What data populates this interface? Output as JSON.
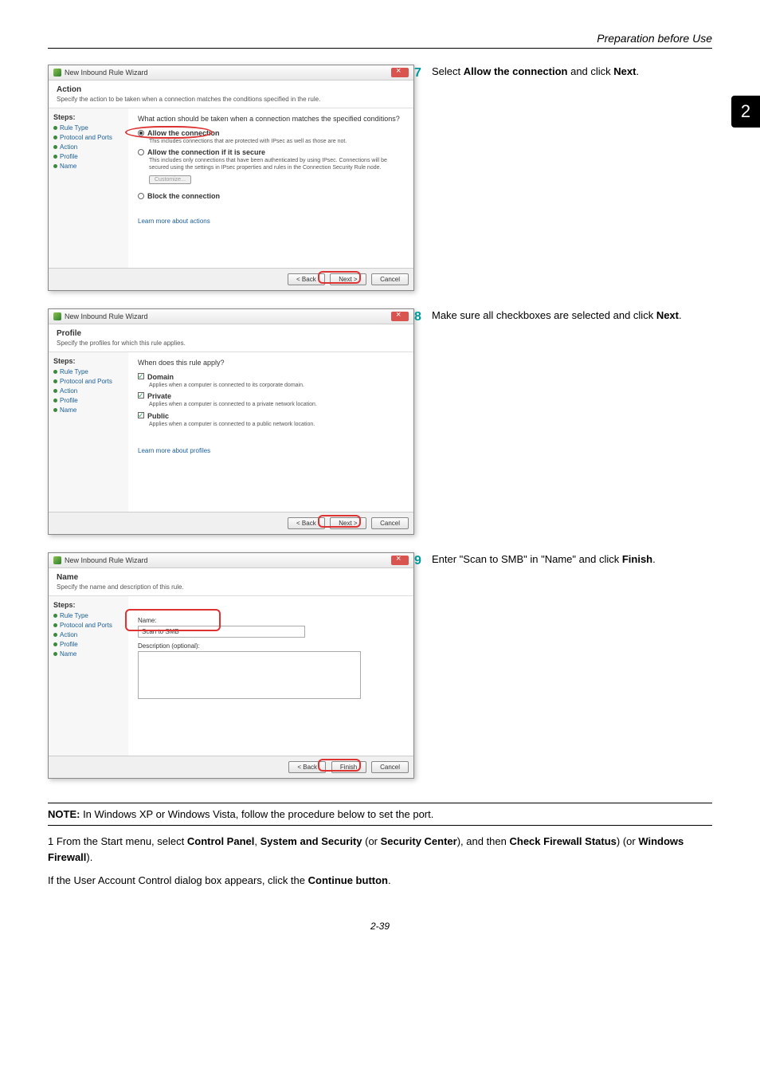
{
  "header": {
    "section_title": "Preparation before Use"
  },
  "chapter_tab": "2",
  "wizard_common": {
    "window_title": "New Inbound Rule Wizard",
    "steps_label": "Steps:",
    "steps": [
      "Rule Type",
      "Protocol and Ports",
      "Action",
      "Profile",
      "Name"
    ],
    "back": "< Back",
    "next": "Next >",
    "finish": "Finish",
    "cancel": "Cancel"
  },
  "step7": {
    "num": "7",
    "text_pre": "Select ",
    "text_bold1": "Allow the connection",
    "text_mid": " and click ",
    "text_bold2": "Next",
    "text_post": ".",
    "panel": {
      "title": "Action",
      "subtitle": "Specify the action to be taken when a connection matches the conditions specified in the rule.",
      "question": "What action should be taken when a connection matches the specified conditions?",
      "opt1_label": "Allow the connection",
      "opt1_desc": "This includes connections that are protected with IPsec as well as those are not.",
      "opt2_label": "Allow the connection if it is secure",
      "opt2_desc": "This includes only connections that have been authenticated by using IPsec. Connections will be secured using the settings in IPsec properties and rules in the Connection Security Rule node.",
      "customize": "Customize...",
      "opt3_label": "Block the connection",
      "learn": "Learn more about actions"
    }
  },
  "step8": {
    "num": "8",
    "text_pre": "Make sure all checkboxes are selected and click ",
    "text_bold": "Next",
    "text_post": ".",
    "panel": {
      "title": "Profile",
      "subtitle": "Specify the profiles for which this rule applies.",
      "question": "When does this rule apply?",
      "chk1": "Domain",
      "chk1_desc": "Applies when a computer is connected to its corporate domain.",
      "chk2": "Private",
      "chk2_desc": "Applies when a computer is connected to a private network location.",
      "chk3": "Public",
      "chk3_desc": "Applies when a computer is connected to a public network location.",
      "learn": "Learn more about profiles"
    }
  },
  "step9": {
    "num": "9",
    "text_pre": "Enter \"Scan to SMB\" in \"Name\" and click ",
    "text_bold": "Finish",
    "text_post": ".",
    "panel": {
      "title": "Name",
      "subtitle": "Specify the name and description of this rule.",
      "name_label": "Name:",
      "name_value": "Scan to SMB",
      "desc_label": "Description (optional):"
    }
  },
  "note": {
    "label": "NOTE:",
    "text": " In Windows XP or Windows Vista, follow the procedure below to set the port."
  },
  "body1": {
    "pre": "1 From the Start menu, select ",
    "b1": "Control Panel",
    "s1": ", ",
    "b2": "System and Security",
    "s2": " (or ",
    "b3": "Security Center",
    "s3": "), and then ",
    "b4": "Check Firewall Status",
    "s4": ") (or ",
    "b5": "Windows Firewall",
    "s5": ")."
  },
  "body2": {
    "pre": "If the User Account Control dialog box appears, click the ",
    "b1": "Continue button",
    "post": "."
  },
  "page_number": "2-39"
}
